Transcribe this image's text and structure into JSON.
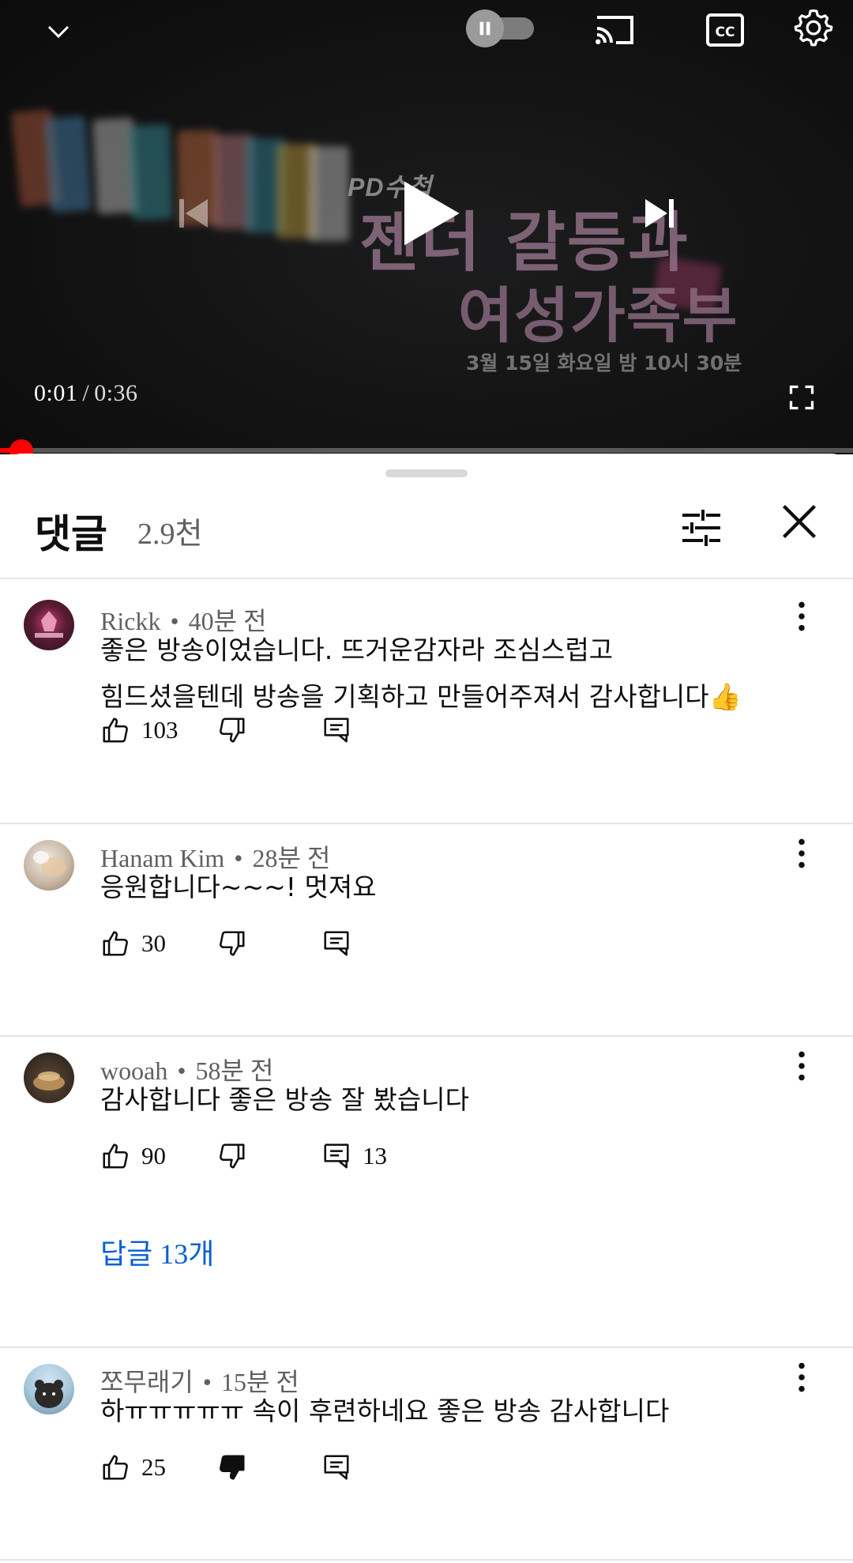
{
  "player": {
    "video_title_overlay": {
      "show_logo": "PD수첩",
      "line1": "젠더 갈등과",
      "line2": "여성가족부",
      "air_time": "3월 15일 화요일 밤 10시 30분"
    },
    "current_time": "0:01",
    "separator": "/",
    "duration": "0:36",
    "progress_fraction": 0.03,
    "autoplay": "on",
    "progress_color": "#ff0000"
  },
  "comments_sheet": {
    "title": "댓글",
    "count": "2.9천",
    "comments": [
      {
        "author": "Rickk",
        "age": "40분 전",
        "text_lines": [
          "좋은 방송이었습니다. 뜨거운감자라 조심스럽고",
          "힘드셨을텐데 방송을 기획하고 만들어주져서 감사합니다👍"
        ],
        "likes": "103",
        "replies_count": "",
        "disliked": false
      },
      {
        "author": "Hanam Kim",
        "age": "28분 전",
        "text_lines": [
          "응원합니다~~~! 멋져요"
        ],
        "likes": "30",
        "replies_count": "",
        "disliked": false
      },
      {
        "author": "wooah",
        "age": "58분 전",
        "text_lines": [
          "감사합니다 좋은 방송 잘 봤습니다"
        ],
        "likes": "90",
        "replies_count": "13",
        "replies_link": "답글 13개",
        "disliked": false
      },
      {
        "author": "쪼무래기",
        "age": "15분 전",
        "text_lines": [
          "하ㅠㅠㅠㅠㅠ 속이 후련하네요 좋은 방송 감사합니다"
        ],
        "likes": "25",
        "replies_count": "",
        "disliked": true
      }
    ],
    "link_color": "#065fd4"
  }
}
